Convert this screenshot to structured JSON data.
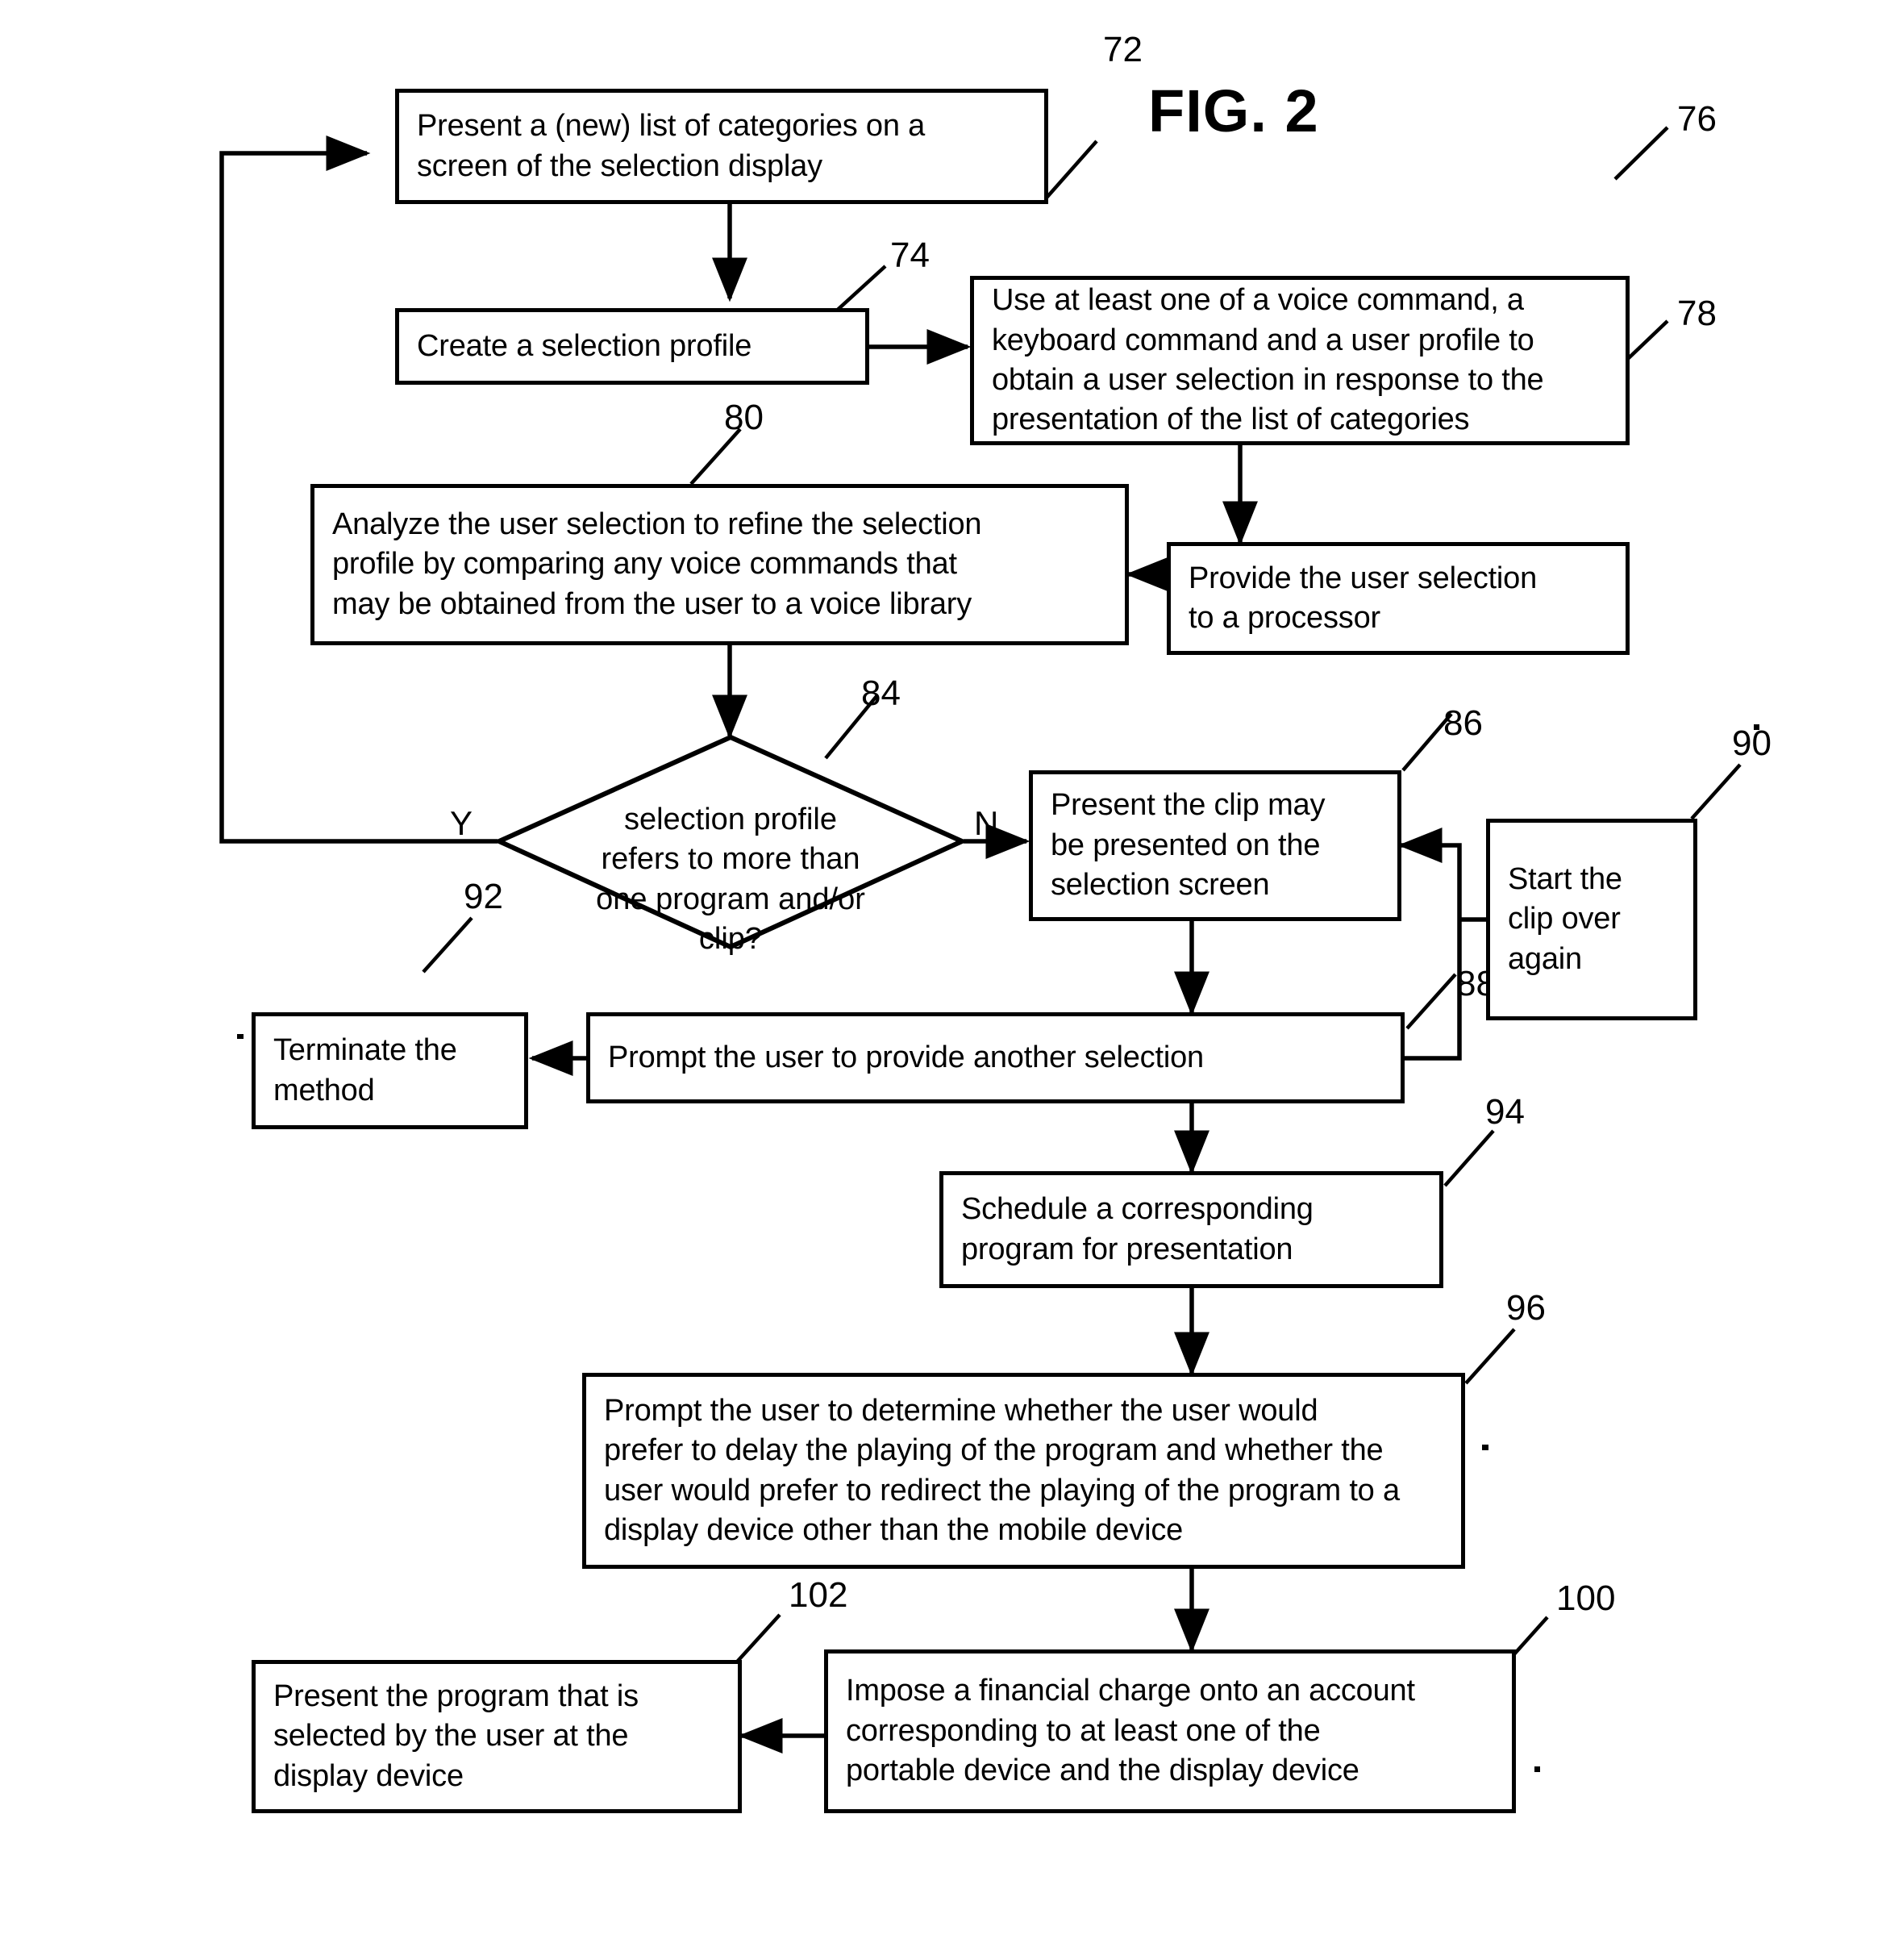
{
  "figure": {
    "title": "FIG. 2"
  },
  "nodes": [
    {
      "id": "n72",
      "ref": "72",
      "text": "Present a (new) list of categories on a\nscreen of the selection display"
    },
    {
      "id": "n74",
      "ref": "74",
      "text": "Create a selection profile"
    },
    {
      "id": "n76",
      "ref": "76",
      "text": "Use at least one of a voice command, a\nkeyboard command and a user profile to\nobtain a user selection in response to the\npresentation of the list of categories"
    },
    {
      "id": "n78",
      "ref": "78",
      "text": "Provide the user selection\nto a processor"
    },
    {
      "id": "n80",
      "ref": "80",
      "text": "Analyze the user selection to refine the selection\nprofile by comparing any voice commands that\nmay be obtained from the user to a voice library"
    },
    {
      "id": "n84",
      "ref": "84",
      "text": "selection profile\nrefers to more than\none program and/or\nclip?",
      "shape": "diamond"
    },
    {
      "id": "n86",
      "ref": "86",
      "text": "Present the clip may\nbe presented on the\nselection screen"
    },
    {
      "id": "n88",
      "ref": "88",
      "text": "Prompt the user to provide another selection"
    },
    {
      "id": "n90",
      "ref": "90",
      "text": "Start the\nclip over\nagain"
    },
    {
      "id": "n92",
      "ref": "92",
      "text": "Terminate the\nmethod"
    },
    {
      "id": "n94",
      "ref": "94",
      "text": "Schedule a corresponding\nprogram for presentation"
    },
    {
      "id": "n96",
      "ref": "96",
      "text": "Prompt the user to determine whether the user would\nprefer to delay the playing of the program and whether the\nuser would prefer to redirect the playing of the program to a\ndisplay device other than the mobile device"
    },
    {
      "id": "n100",
      "ref": "100",
      "text": "Impose a financial charge onto an account\ncorresponding to at least one of the\nportable device and the display device"
    },
    {
      "id": "n102",
      "ref": "102",
      "text": "Present the program that is\nselected by the user at the\ndisplay device"
    }
  ],
  "branch_labels": {
    "yes": "Y",
    "no": "N"
  }
}
